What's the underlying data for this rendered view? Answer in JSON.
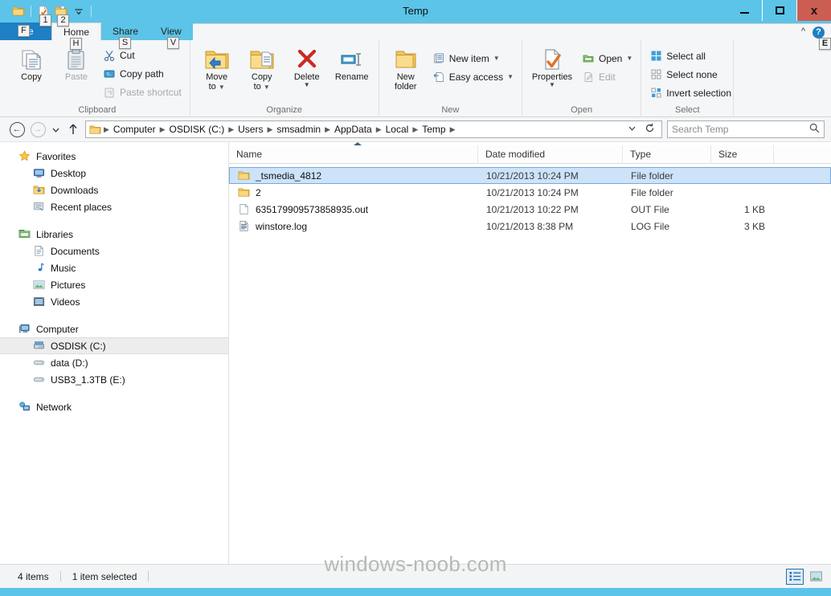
{
  "window": {
    "title": "Temp",
    "controls": {
      "minimize": "minimize-button",
      "maximize": "maximize-button",
      "close_label": "x"
    }
  },
  "quick_access": {
    "items": [
      {
        "icon": "folder-icon",
        "keytip": ""
      },
      {
        "icon": "properties-icon",
        "keytip": "1"
      },
      {
        "icon": "new-folder-icon",
        "keytip": "2"
      }
    ],
    "dropdown_keytip": ""
  },
  "ribbon": {
    "file_tab": {
      "label": "File",
      "keytip": "F"
    },
    "tabs": [
      {
        "label": "Home",
        "keytip": "H",
        "active": true
      },
      {
        "label": "Share",
        "keytip": "S",
        "active": false
      },
      {
        "label": "View",
        "keytip": "V",
        "active": false
      }
    ],
    "help_keytip": "E",
    "collapse_icon": "chevron-up-icon",
    "help_icon": "help-icon",
    "groups": [
      {
        "title": "Clipboard",
        "big_buttons": [
          {
            "label": "Copy",
            "label2": "",
            "icon": "copy-icon",
            "disabled": false
          },
          {
            "label": "Paste",
            "label2": "",
            "icon": "paste-icon",
            "disabled": true
          }
        ],
        "small_buttons": [
          {
            "label": "Cut",
            "icon": "scissors-icon",
            "disabled": false
          },
          {
            "label": "Copy path",
            "icon": "copy-path-icon",
            "disabled": false
          },
          {
            "label": "Paste shortcut",
            "icon": "paste-shortcut-icon",
            "disabled": true
          }
        ]
      },
      {
        "title": "Organize",
        "big_buttons": [
          {
            "label": "Move",
            "label2": "to",
            "icon": "move-to-icon",
            "disabled": false,
            "caret": true
          },
          {
            "label": "Copy",
            "label2": "to",
            "icon": "copy-to-icon",
            "disabled": false,
            "caret": true
          },
          {
            "label": "Delete",
            "label2": "",
            "icon": "delete-icon",
            "disabled": false,
            "caret_below": true
          },
          {
            "label": "Rename",
            "label2": "",
            "icon": "rename-icon",
            "disabled": false
          }
        ],
        "small_buttons": []
      },
      {
        "title": "New",
        "big_buttons": [
          {
            "label": "New",
            "label2": "folder",
            "icon": "new-folder-icon",
            "disabled": false
          }
        ],
        "small_buttons": [
          {
            "label": "New item",
            "icon": "new-item-icon",
            "disabled": false,
            "caret": true
          },
          {
            "label": "Easy access",
            "icon": "easy-access-icon",
            "disabled": false,
            "caret": true
          }
        ]
      },
      {
        "title": "Open",
        "big_buttons": [
          {
            "label": "Properties",
            "label2": "",
            "icon": "properties-icon",
            "disabled": false,
            "caret_below": true
          }
        ],
        "small_buttons": [
          {
            "label": "Open",
            "icon": "open-icon",
            "disabled": false,
            "caret": true
          },
          {
            "label": "Edit",
            "icon": "edit-icon",
            "disabled": true
          }
        ]
      },
      {
        "title": "Select",
        "big_buttons": [],
        "small_buttons": [
          {
            "label": "Select all",
            "icon": "select-all-icon",
            "disabled": false
          },
          {
            "label": "Select none",
            "icon": "select-none-icon",
            "disabled": false
          },
          {
            "label": "Invert selection",
            "icon": "invert-selection-icon",
            "disabled": false
          }
        ]
      }
    ]
  },
  "addressbar": {
    "back": {
      "icon": "back-arrow-icon",
      "enabled": true
    },
    "forward": {
      "icon": "forward-arrow-icon",
      "enabled": false
    },
    "recent": {
      "icon": "chevron-down-icon"
    },
    "up": {
      "icon": "up-arrow-icon",
      "enabled": true
    },
    "breadcrumb": [
      "Computer",
      "OSDISK (C:)",
      "Users",
      "smsadmin",
      "AppData",
      "Local",
      "Temp"
    ],
    "dropdown_icon": "chevron-down-icon",
    "refresh_icon": "refresh-icon"
  },
  "search": {
    "placeholder": "Search Temp",
    "value": "",
    "icon": "search-icon"
  },
  "navpane": {
    "sections": [
      {
        "header": {
          "label": "Favorites",
          "icon": "star-icon"
        },
        "items": [
          {
            "label": "Desktop",
            "icon": "desktop-icon",
            "selected": false
          },
          {
            "label": "Downloads",
            "icon": "downloads-icon",
            "selected": false
          },
          {
            "label": "Recent places",
            "icon": "recent-places-icon",
            "selected": false
          }
        ]
      },
      {
        "header": {
          "label": "Libraries",
          "icon": "libraries-icon"
        },
        "items": [
          {
            "label": "Documents",
            "icon": "documents-icon",
            "selected": false
          },
          {
            "label": "Music",
            "icon": "music-icon",
            "selected": false
          },
          {
            "label": "Pictures",
            "icon": "pictures-icon",
            "selected": false
          },
          {
            "label": "Videos",
            "icon": "videos-icon",
            "selected": false
          }
        ]
      },
      {
        "header": {
          "label": "Computer",
          "icon": "computer-icon"
        },
        "items": [
          {
            "label": "OSDISK (C:)",
            "icon": "harddrive-icon",
            "selected": true
          },
          {
            "label": "data (D:)",
            "icon": "drive-icon",
            "selected": false
          },
          {
            "label": "USB3_1.3TB (E:)",
            "icon": "drive-icon",
            "selected": false
          }
        ]
      },
      {
        "header": {
          "label": "Network",
          "icon": "network-icon"
        },
        "items": []
      }
    ]
  },
  "filelist": {
    "columns": [
      "Name",
      "Date modified",
      "Type",
      "Size"
    ],
    "sort_column": "Name",
    "sort_direction": "ascending",
    "rows": [
      {
        "name": "_tsmedia_4812",
        "date_modified": "10/21/2013 10:24 PM",
        "type": "File folder",
        "size": "",
        "icon": "folder-icon",
        "selected": true
      },
      {
        "name": "2",
        "date_modified": "10/21/2013 10:24 PM",
        "type": "File folder",
        "size": "",
        "icon": "folder-icon",
        "selected": false
      },
      {
        "name": "635179909573858935.out",
        "date_modified": "10/21/2013 10:22 PM",
        "type": "OUT File",
        "size": "1 KB",
        "icon": "generic-file-icon",
        "selected": false
      },
      {
        "name": "winstore.log",
        "date_modified": "10/21/2013 8:38 PM",
        "type": "LOG File",
        "size": "3 KB",
        "icon": "log-file-icon",
        "selected": false
      }
    ]
  },
  "statusbar": {
    "item_count": "4 items",
    "selection_info": "1 item selected",
    "views": [
      {
        "name": "details-view-button",
        "active": true
      },
      {
        "name": "large-icons-view-button",
        "active": false
      }
    ]
  },
  "watermark": "windows-noob.com",
  "colors": {
    "accent": "#5cc4e8",
    "file_tab": "#1e7fc4",
    "close_button": "#cc5d52",
    "selection": "#cce3fa",
    "selection_border": "#7ba7d7",
    "ribbon_bg": "#f4f6f7"
  }
}
